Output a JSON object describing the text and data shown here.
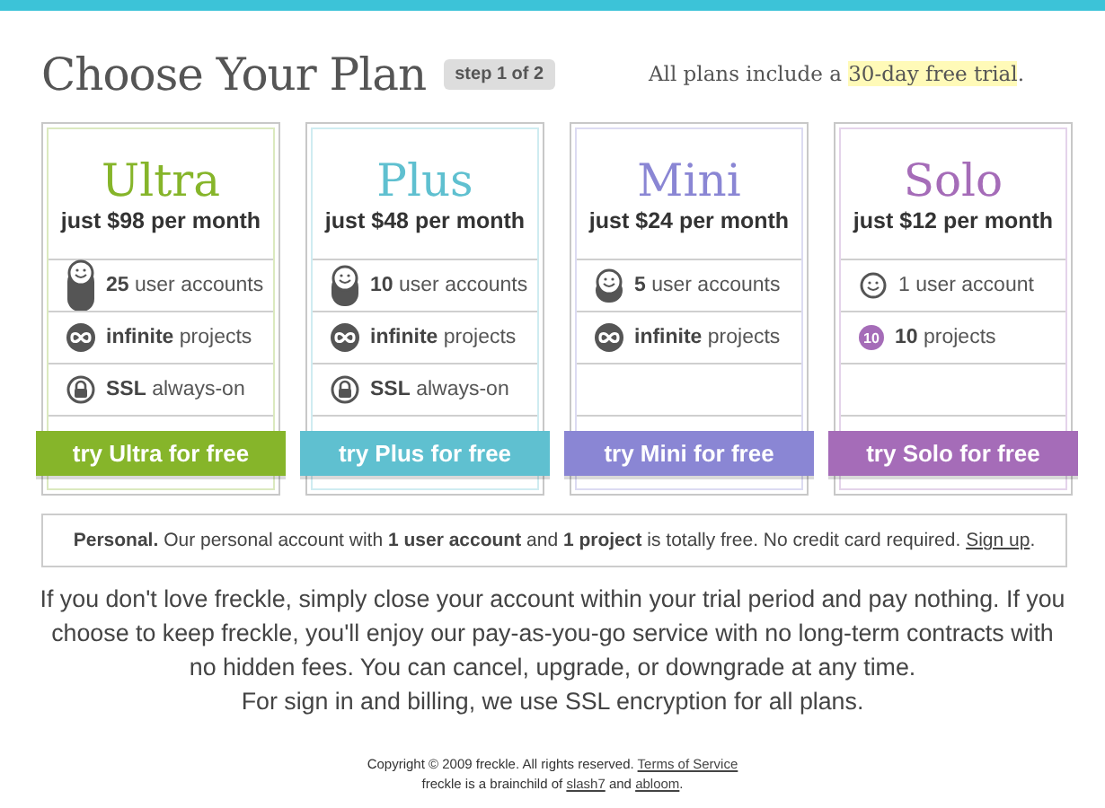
{
  "header": {
    "title": "Choose Your Plan",
    "step_badge": "step 1 of 2",
    "tagline": [
      {
        "text": "All plans include a ",
        "highlighted": false
      },
      {
        "text": "30-day free trial",
        "highlighted": true
      },
      {
        "text": ".",
        "highlighted": false
      }
    ]
  },
  "plans": [
    {
      "name": "Ultra",
      "price": "just $98 per month",
      "color": "#86b52a",
      "button": "try Ultra for free",
      "features": [
        {
          "kind": "users-tall",
          "bold": "25",
          "text": "user accounts"
        },
        {
          "kind": "infinite",
          "bold": "infinite",
          "text": "projects"
        },
        {
          "kind": "ssl",
          "bold": "SSL",
          "text": "always-on"
        }
      ]
    },
    {
      "name": "Plus",
      "price": "just $48 per month",
      "color": "#5fc0d0",
      "button": "try Plus for free",
      "features": [
        {
          "kind": "users-medium",
          "bold": "10",
          "text": "user accounts"
        },
        {
          "kind": "infinite",
          "bold": "infinite",
          "text": "projects"
        },
        {
          "kind": "ssl",
          "bold": "SSL",
          "text": "always-on"
        }
      ]
    },
    {
      "name": "Mini",
      "price": "just $24 per month",
      "color": "#8a86d4",
      "button": "try Mini for free",
      "features": [
        {
          "kind": "users-short",
          "bold": "5",
          "text": "user accounts"
        },
        {
          "kind": "infinite",
          "bold": "infinite",
          "text": "projects"
        }
      ]
    },
    {
      "name": "Solo",
      "price": "just $12 per month",
      "color": "#a56cb8",
      "button": "try Solo for free",
      "features": [
        {
          "kind": "user",
          "text": "1 user account"
        },
        {
          "kind": "count",
          "badge": "10",
          "bold": "10",
          "text": "projects"
        }
      ]
    }
  ],
  "personal": {
    "text": "**Personal.** Our personal account with **1 user account** and **1 project** is totally free. No credit card required. ",
    "link": "Sign up",
    "after": "."
  },
  "info": [
    "If you don't love freckle, simply close your account within your trial period and pay nothing. If you choose to keep freckle, you'll enjoy our pay-as-you-go service with no long-term contracts with no hidden fees. You can cancel, upgrade, or downgrade at any time.",
    "For sign in and billing, we use SSL encryption for all plans."
  ],
  "footer": [
    [
      {
        "text": "Copyright © 2009 freckle. All rights reserved. ",
        "link": false
      },
      {
        "text": "Terms of Service",
        "link": true
      }
    ],
    [
      {
        "text": "freckle is a brainchild of ",
        "link": false
      },
      {
        "text": "slash7",
        "link": true
      },
      {
        "text": " and ",
        "link": false
      },
      {
        "text": "abloom",
        "link": true
      },
      {
        "text": ".",
        "link": false
      }
    ]
  ]
}
